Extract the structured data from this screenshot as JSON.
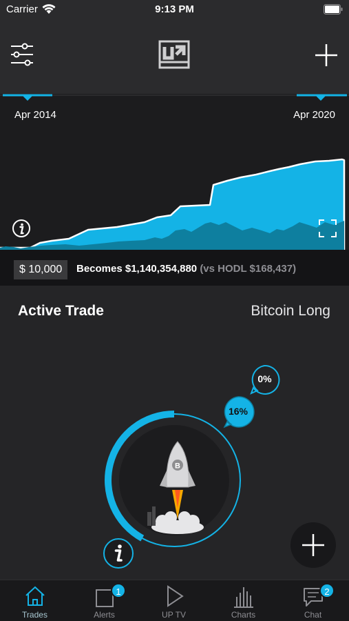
{
  "status": {
    "carrier": "Carrier",
    "time": "9:13 PM"
  },
  "chart": {
    "start_label": "Apr 2014",
    "end_label": "Apr 2020"
  },
  "result": {
    "amount": "$ 10,000",
    "becomes": "Becomes $1,140,354,880",
    "hodl": "(vs HODL $168,437)"
  },
  "trade": {
    "title": "Active Trade",
    "name": "Bitcoin Long",
    "primary_pct": "16%",
    "secondary_pct": "0%",
    "progress": 0.42
  },
  "tabs": [
    {
      "label": "Trades",
      "icon": "home-icon",
      "active": true
    },
    {
      "label": "Alerts",
      "icon": "alert-icon",
      "badge": "1"
    },
    {
      "label": "UP TV",
      "icon": "play-icon"
    },
    {
      "label": "Charts",
      "icon": "bar-chart-icon"
    },
    {
      "label": "Chat",
      "icon": "chat-icon",
      "badge": "2"
    }
  ],
  "colors": {
    "accent": "#14b3e6",
    "accent_dark": "#0e7f9f",
    "background": "#252527"
  }
}
